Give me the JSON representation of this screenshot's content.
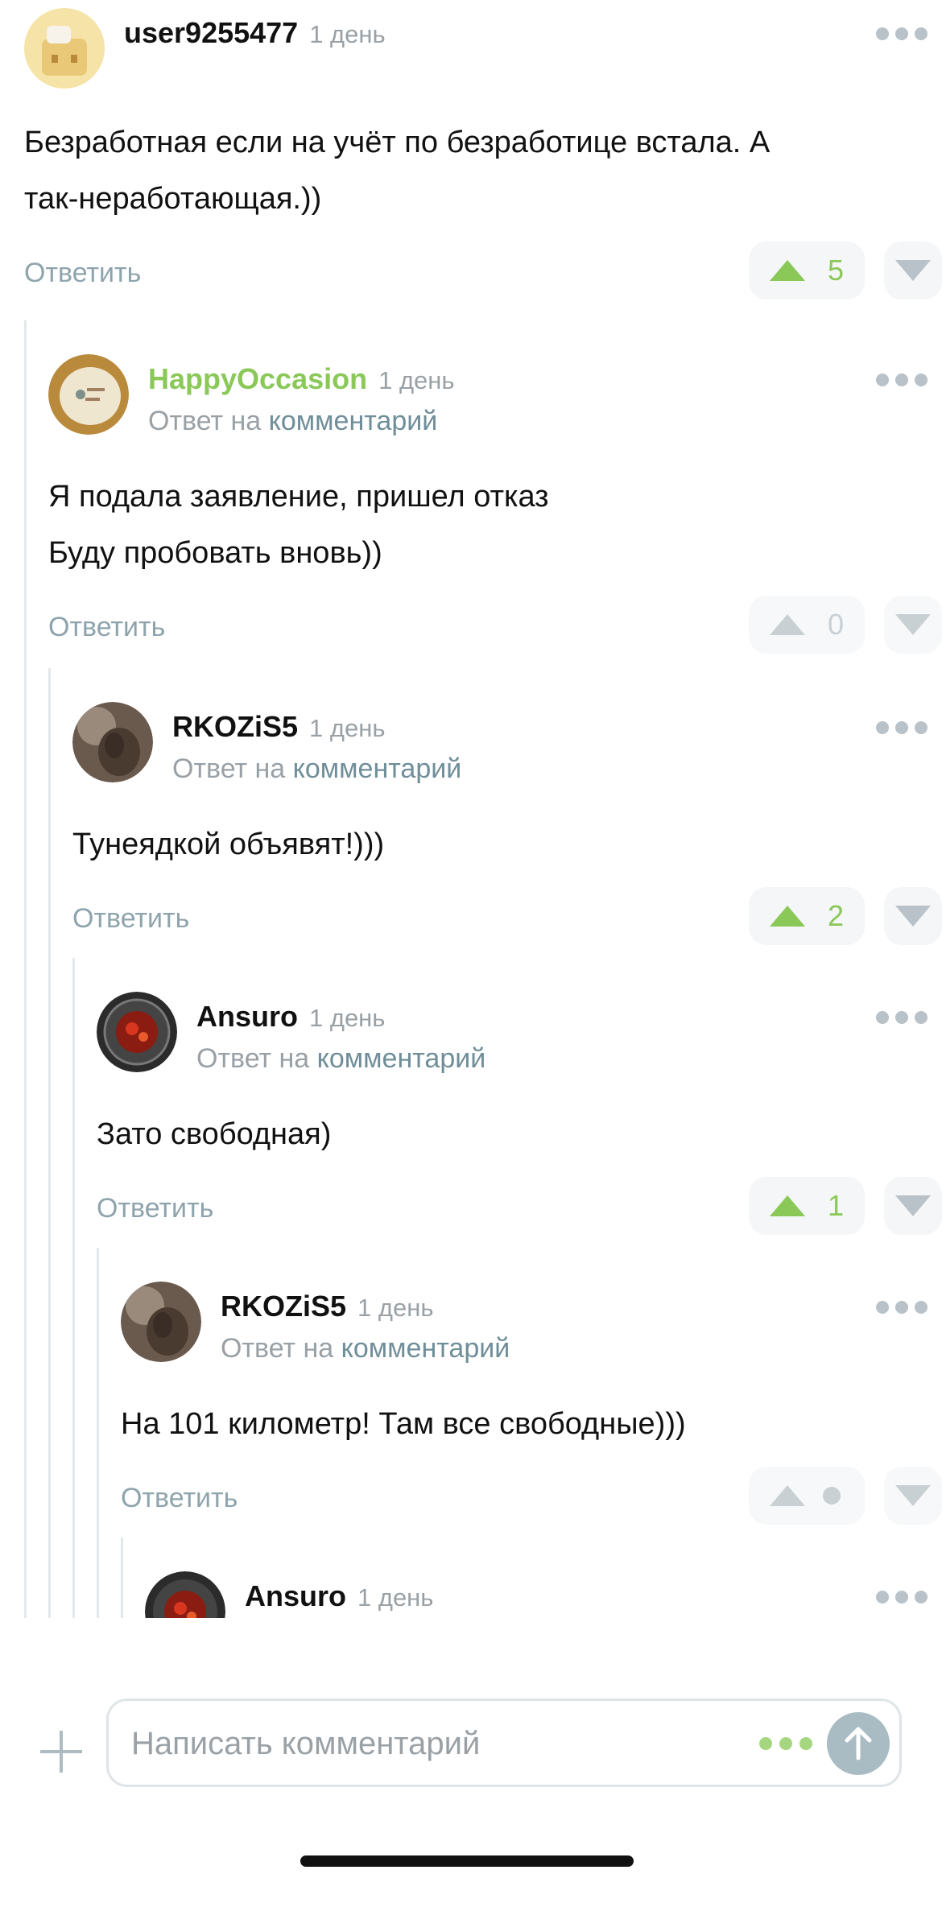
{
  "colors": {
    "accent_green": "#8ac858",
    "muted_text": "#9aa1a6",
    "link_text": "#6f8e99",
    "reply_text": "#8ea4ad",
    "thread_line": "#e3e8ea",
    "vote_bg": "#f4f6f7"
  },
  "comments": [
    {
      "username": "user9255477",
      "time": "1 день",
      "text": [
        "Безработная если на учёт по безработице встала. А",
        "так-неработающая.))"
      ],
      "reply_label": "Ответить",
      "score": "5",
      "upvoted": true
    },
    {
      "username": "HappyOccasion",
      "time": "1 день",
      "reply_to_prefix": "Ответ на",
      "reply_to_link": "комментарий",
      "text": [
        "Я подала заявление, пришел отказ",
        "Буду пробовать вновь))"
      ],
      "reply_label": "Ответить",
      "score": "0",
      "upvoted": false
    },
    {
      "username": "RKOZiS5",
      "time": "1 день",
      "reply_to_prefix": "Ответ на",
      "reply_to_link": "комментарий",
      "text": [
        "Тунеядкой объявят!)))"
      ],
      "reply_label": "Ответить",
      "score": "2",
      "upvoted": true
    },
    {
      "username": "Ansuro",
      "time": "1 день",
      "reply_to_prefix": "Ответ на",
      "reply_to_link": "комментарий",
      "text": [
        "Зато свободная)"
      ],
      "reply_label": "Ответить",
      "score": "1",
      "upvoted": true
    },
    {
      "username": "RKOZiS5",
      "time": "1 день",
      "reply_to_prefix": "Ответ на",
      "reply_to_link": "комментарий",
      "text": [
        "На 101 километр! Там все свободные)))"
      ],
      "reply_label": "Ответить",
      "score_hidden": true
    },
    {
      "username": "Ansuro",
      "time": "1 день"
    }
  ],
  "composer": {
    "placeholder": "Написать комментарий",
    "add_icon": "plus-icon",
    "send_icon": "arrow-up-icon"
  }
}
